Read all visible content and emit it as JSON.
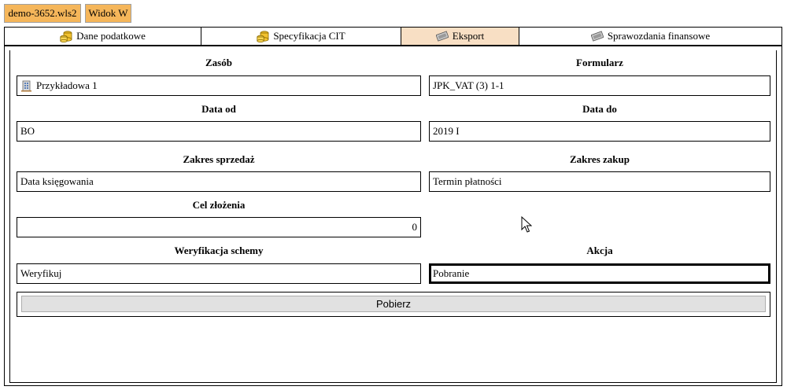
{
  "header": {
    "file_label": "demo-3652.wls2",
    "view_label": "Widok W"
  },
  "tabs": [
    {
      "label": "Dane podatkowe",
      "icon": "coins-icon",
      "active": false
    },
    {
      "label": "Specyfikacja CIT",
      "icon": "coins-icon",
      "active": false
    },
    {
      "label": "Eksport",
      "icon": "export-icon",
      "active": true
    },
    {
      "label": "Sprawozdania finansowe",
      "icon": "export-icon",
      "active": false
    }
  ],
  "form": {
    "resource": {
      "label": "Zasób",
      "value": "Przykładowa 1",
      "icon": "building-icon"
    },
    "form_type": {
      "label": "Formularz",
      "value": "JPK_VAT (3) 1-1"
    },
    "date_from": {
      "label": "Data od",
      "value": "BO"
    },
    "date_to": {
      "label": "Data do",
      "value": "2019 I"
    },
    "sales_range": {
      "label": "Zakres sprzedaż",
      "value": "Data księgowania"
    },
    "purchase_range": {
      "label": "Zakres zakup",
      "value": "Termin płatności"
    },
    "purpose": {
      "label": "Cel złożenia",
      "value": "0"
    },
    "schema_verification": {
      "label": "Weryfikacja schemy",
      "value": "Weryfikuj"
    },
    "action": {
      "label": "Akcja",
      "value": "Pobranie"
    }
  },
  "action_button": {
    "label": "Pobierz"
  },
  "colors": {
    "top_button_bg": "#f5b65a",
    "active_tab_bg": "#f8dfc4",
    "button_bg": "#e1e1e1"
  }
}
